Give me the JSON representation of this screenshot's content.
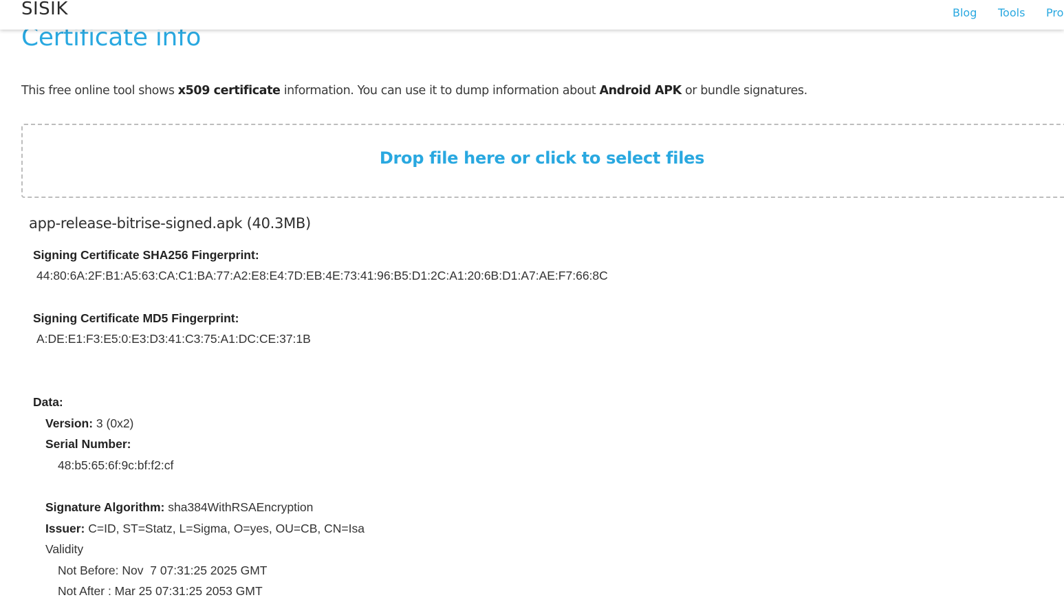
{
  "header": {
    "brand": "SISIK",
    "nav": [
      "Blog",
      "Tools",
      "Pro"
    ]
  },
  "page": {
    "title": "Certificate info",
    "intro": {
      "part1": "This free online tool shows ",
      "bold1": "x509 certificate",
      "part2": " information. You can use it to dump information about ",
      "bold2": "Android APK",
      "part3": " or bundle signatures."
    },
    "dropzone_label": "Drop file here or click to select files"
  },
  "result": {
    "file": "app-release-bitrise-signed.apk (40.3MB)",
    "sha256_label": "Signing Certificate SHA256 Fingerprint:",
    "sha256_value": "44:80:6A:2F:B1:A5:63:CA:C1:BA:77:A2:E8:E4:7D:EB:4E:73:41:96:B5:D1:2C:A1:20:6B:D1:A7:AE:F7:66:8C",
    "md5_label": "Signing Certificate MD5 Fingerprint:",
    "md5_value": "A:DE:E1:F3:E5:0:E3:D3:41:C3:75:A1:DC:CE:37:1B",
    "data_label": "Data:",
    "version_label": "Version:",
    "version_value": " 3 (0x2)",
    "serial_label": "Serial Number:",
    "serial_value": "48:b5:65:6f:9c:bf:f2:cf",
    "sigalg_label": "Signature Algorithm:",
    "sigalg_value": " sha384WithRSAEncryption",
    "issuer_label": "Issuer:",
    "issuer_value": " C=ID, ST=Statz, L=Sigma, O=yes, OU=CB, CN=Isa",
    "validity_label": "Validity",
    "not_before": "Not Before: Nov  7 07:31:25 2025 GMT",
    "not_after": "Not After : Mar 25 07:31:25 2053 GMT"
  },
  "colors": {
    "accent": "#29a8e0",
    "text": "#333333",
    "dashed_border": "#bdbdbd"
  }
}
